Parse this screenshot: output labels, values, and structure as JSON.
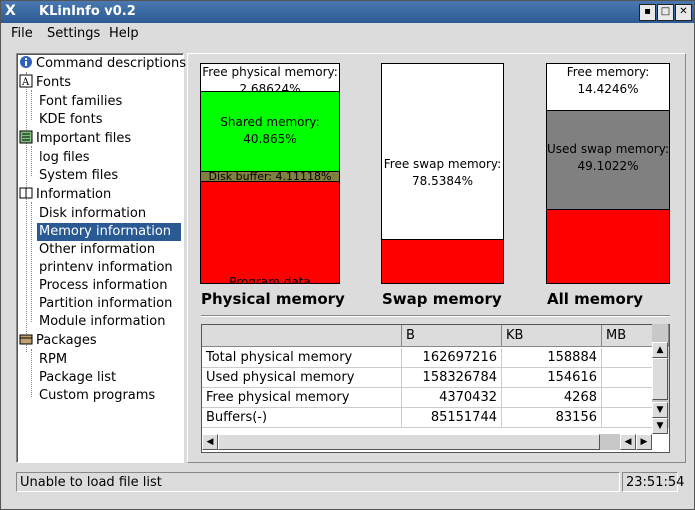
{
  "window": {
    "title": "KLinInfo v0.2",
    "logo": "X"
  },
  "menu": {
    "file": "File",
    "settings": "Settings",
    "help": "Help"
  },
  "tree": {
    "items": [
      {
        "label": "Command descriptions",
        "icon": "info-icon"
      },
      {
        "label": "Fonts",
        "icon": "font-icon"
      },
      {
        "label": "Font families"
      },
      {
        "label": "KDE fonts"
      },
      {
        "label": "Important files",
        "icon": "files-icon"
      },
      {
        "label": "log files"
      },
      {
        "label": "System files"
      },
      {
        "label": "Information",
        "icon": "info-book-icon"
      },
      {
        "label": "Disk information"
      },
      {
        "label": "Memory information"
      },
      {
        "label": "Other information"
      },
      {
        "label": "printenv information"
      },
      {
        "label": "Process information"
      },
      {
        "label": "Partition information"
      },
      {
        "label": "Module information"
      },
      {
        "label": "Packages",
        "icon": "package-icon"
      },
      {
        "label": "RPM"
      },
      {
        "label": "Package list"
      },
      {
        "label": "Custom programs"
      }
    ],
    "selected": "Memory information"
  },
  "charts": {
    "physical": {
      "title": "Physical memory",
      "segments": [
        {
          "label": "Free physical memory: 2.68624%",
          "color": "#ffffff"
        },
        {
          "label": "Shared memory: 40.865%",
          "color": "#00ff00"
        },
        {
          "label": "Disk buffer: 4.11118%",
          "color": "#808040"
        },
        {
          "label": "Program data",
          "color": "#ff0000"
        }
      ]
    },
    "swap": {
      "title": "Swap memory",
      "segments": [
        {
          "label": "Free swap memory: 78.5384%",
          "color": "#ffffff"
        },
        {
          "label": "",
          "color": "#ff0000"
        }
      ]
    },
    "all": {
      "title": "All memory",
      "segments": [
        {
          "label": "Free memory: 14.4246%",
          "color": "#ffffff"
        },
        {
          "label": "Used swap memory: 49.1022%",
          "color": "#808080"
        },
        {
          "label": "",
          "color": "#ff0000"
        }
      ]
    }
  },
  "table": {
    "columns": [
      "",
      "B",
      "KB",
      "MB"
    ],
    "rows": [
      [
        "Total physical memory",
        "162697216",
        "158884",
        ""
      ],
      [
        "Used physical memory",
        "158326784",
        "154616",
        ""
      ],
      [
        "Free physical memory",
        "4370432",
        "4268",
        ""
      ],
      [
        "Buffers(-)",
        "85151744",
        "83156",
        ""
      ]
    ]
  },
  "status": {
    "message": "Unable to load file list",
    "clock": "23:51:54"
  }
}
